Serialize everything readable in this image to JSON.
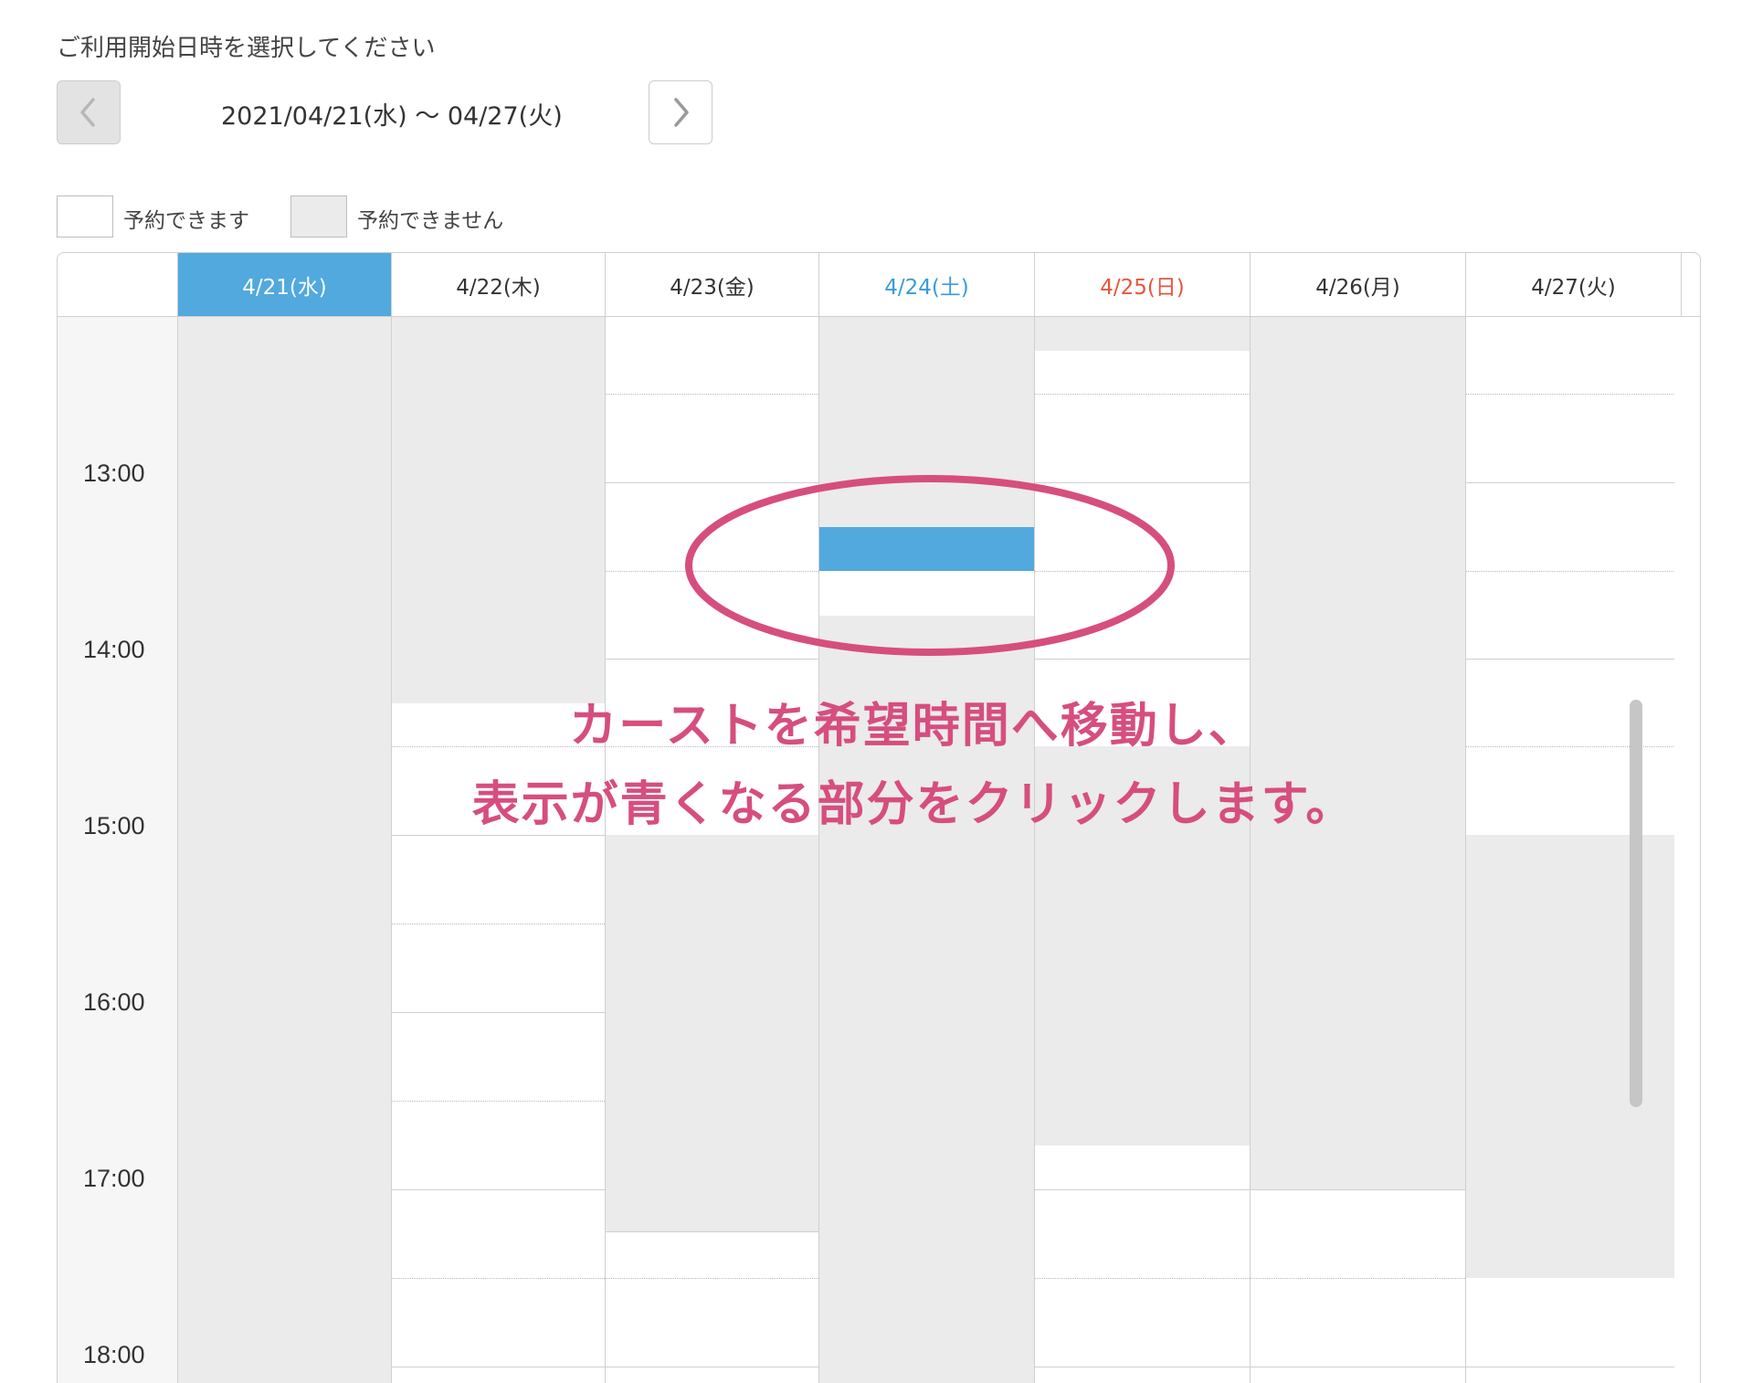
{
  "header": {
    "title": "ご利用開始日時を選択してください",
    "range_text": "2021/04/21(水) 〜 04/27(火)",
    "prev_icon": "chevron-left-icon",
    "next_icon": "chevron-right-icon"
  },
  "legend": {
    "available_label": "予約できます",
    "unavailable_label": "予約できません"
  },
  "calendar": {
    "days": [
      {
        "label": "4/21(水)",
        "color": "#ffffff",
        "bg": "#51a9de"
      },
      {
        "label": "4/22(木)",
        "color": "#333333",
        "bg": "#ffffff"
      },
      {
        "label": "4/23(金)",
        "color": "#333333",
        "bg": "#ffffff"
      },
      {
        "label": "4/24(土)",
        "color": "#3a9ad9",
        "bg": "#ffffff"
      },
      {
        "label": "4/25(日)",
        "color": "#e4573d",
        "bg": "#ffffff"
      },
      {
        "label": "4/26(月)",
        "color": "#333333",
        "bg": "#ffffff"
      },
      {
        "label": "4/27(火)",
        "color": "#333333",
        "bg": "#ffffff"
      }
    ],
    "times": [
      "13:00",
      "14:00",
      "15:00",
      "16:00",
      "17:00",
      "18:00"
    ]
  },
  "annotation": {
    "line1": "カーストを希望時間へ移動し、",
    "line2": "表示が青くなる部分をクリックします。",
    "color": "#d64e7e"
  },
  "colors": {
    "unavailable": "#ebebeb",
    "selected": "#51a9de",
    "border": "#cfcfcf"
  }
}
